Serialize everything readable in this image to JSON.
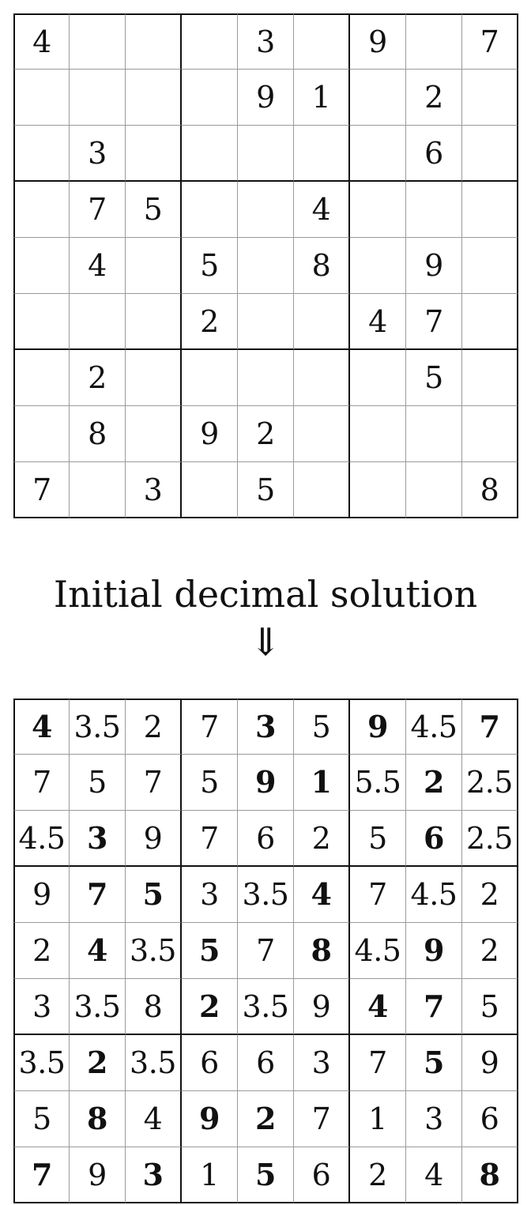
{
  "puzzle": [
    [
      "4",
      "",
      "",
      "",
      "3",
      "",
      "9",
      "",
      "7"
    ],
    [
      "",
      "",
      "",
      "",
      "9",
      "1",
      "",
      "2",
      ""
    ],
    [
      "",
      "3",
      "",
      "",
      "",
      "",
      "",
      "6",
      ""
    ],
    [
      "",
      "7",
      "5",
      "",
      "",
      "4",
      "",
      "",
      ""
    ],
    [
      "",
      "4",
      "",
      "5",
      "",
      "8",
      "",
      "9",
      ""
    ],
    [
      "",
      "",
      "",
      "2",
      "",
      "",
      "4",
      "7",
      ""
    ],
    [
      "",
      "2",
      "",
      "",
      "",
      "",
      "",
      "5",
      ""
    ],
    [
      "",
      "8",
      "",
      "9",
      "2",
      "",
      "",
      "",
      ""
    ],
    [
      "7",
      "",
      "3",
      "",
      "5",
      "",
      "",
      "",
      "8"
    ]
  ],
  "caption": "Initial decimal solution",
  "arrow": "⇓",
  "solution": [
    [
      "4",
      "3.5",
      "2",
      "7",
      "3",
      "5",
      "9",
      "4.5",
      "7"
    ],
    [
      "7",
      "5",
      "7",
      "5",
      "9",
      "1",
      "5.5",
      "2",
      "2.5"
    ],
    [
      "4.5",
      "3",
      "9",
      "7",
      "6",
      "2",
      "5",
      "6",
      "2.5"
    ],
    [
      "9",
      "7",
      "5",
      "3",
      "3.5",
      "4",
      "7",
      "4.5",
      "2"
    ],
    [
      "2",
      "4",
      "3.5",
      "5",
      "7",
      "8",
      "4.5",
      "9",
      "2"
    ],
    [
      "3",
      "3.5",
      "8",
      "2",
      "3.5",
      "9",
      "4",
      "7",
      "5"
    ],
    [
      "3.5",
      "2",
      "3.5",
      "6",
      "6",
      "3",
      "7",
      "5",
      "9"
    ],
    [
      "5",
      "8",
      "4",
      "9",
      "2",
      "7",
      "1",
      "3",
      "6"
    ],
    [
      "7",
      "9",
      "3",
      "1",
      "5",
      "6",
      "2",
      "4",
      "8"
    ]
  ]
}
